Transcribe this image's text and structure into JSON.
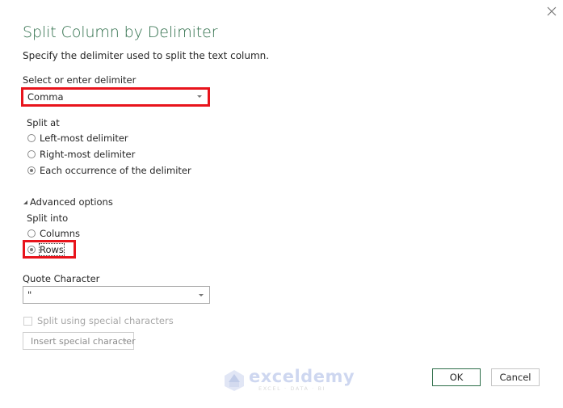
{
  "dialog": {
    "title": "Split Column by Delimiter",
    "subtitle": "Specify the delimiter used to split the text column.",
    "close_icon": "close-x-icon"
  },
  "delimiter": {
    "label": "Select or enter delimiter",
    "value": "Comma"
  },
  "split_at": {
    "label": "Split at",
    "options": [
      {
        "label": "Left-most delimiter",
        "checked": false
      },
      {
        "label": "Right-most delimiter",
        "checked": false
      },
      {
        "label": "Each occurrence of the delimiter",
        "checked": true
      }
    ]
  },
  "advanced": {
    "toggle_label": "Advanced options",
    "expanded": true,
    "split_into": {
      "label": "Split into",
      "options": [
        {
          "label": "Columns",
          "checked": false
        },
        {
          "label": "Rows",
          "checked": true
        }
      ]
    },
    "quote_character": {
      "label": "Quote Character",
      "value": "\""
    },
    "special_chars_checkbox": {
      "label": "Split using special characters",
      "checked": false,
      "disabled": true
    },
    "insert_special_button": {
      "label": "Insert special character",
      "disabled": true
    }
  },
  "footer": {
    "ok_label": "OK",
    "cancel_label": "Cancel"
  },
  "watermark": {
    "name": "exceldemy",
    "tagline": "EXCEL · DATA · BI"
  },
  "colors": {
    "title_green": "#2e6e4a",
    "highlight_red": "#e8141c",
    "ok_border": "#2e6e4a"
  }
}
